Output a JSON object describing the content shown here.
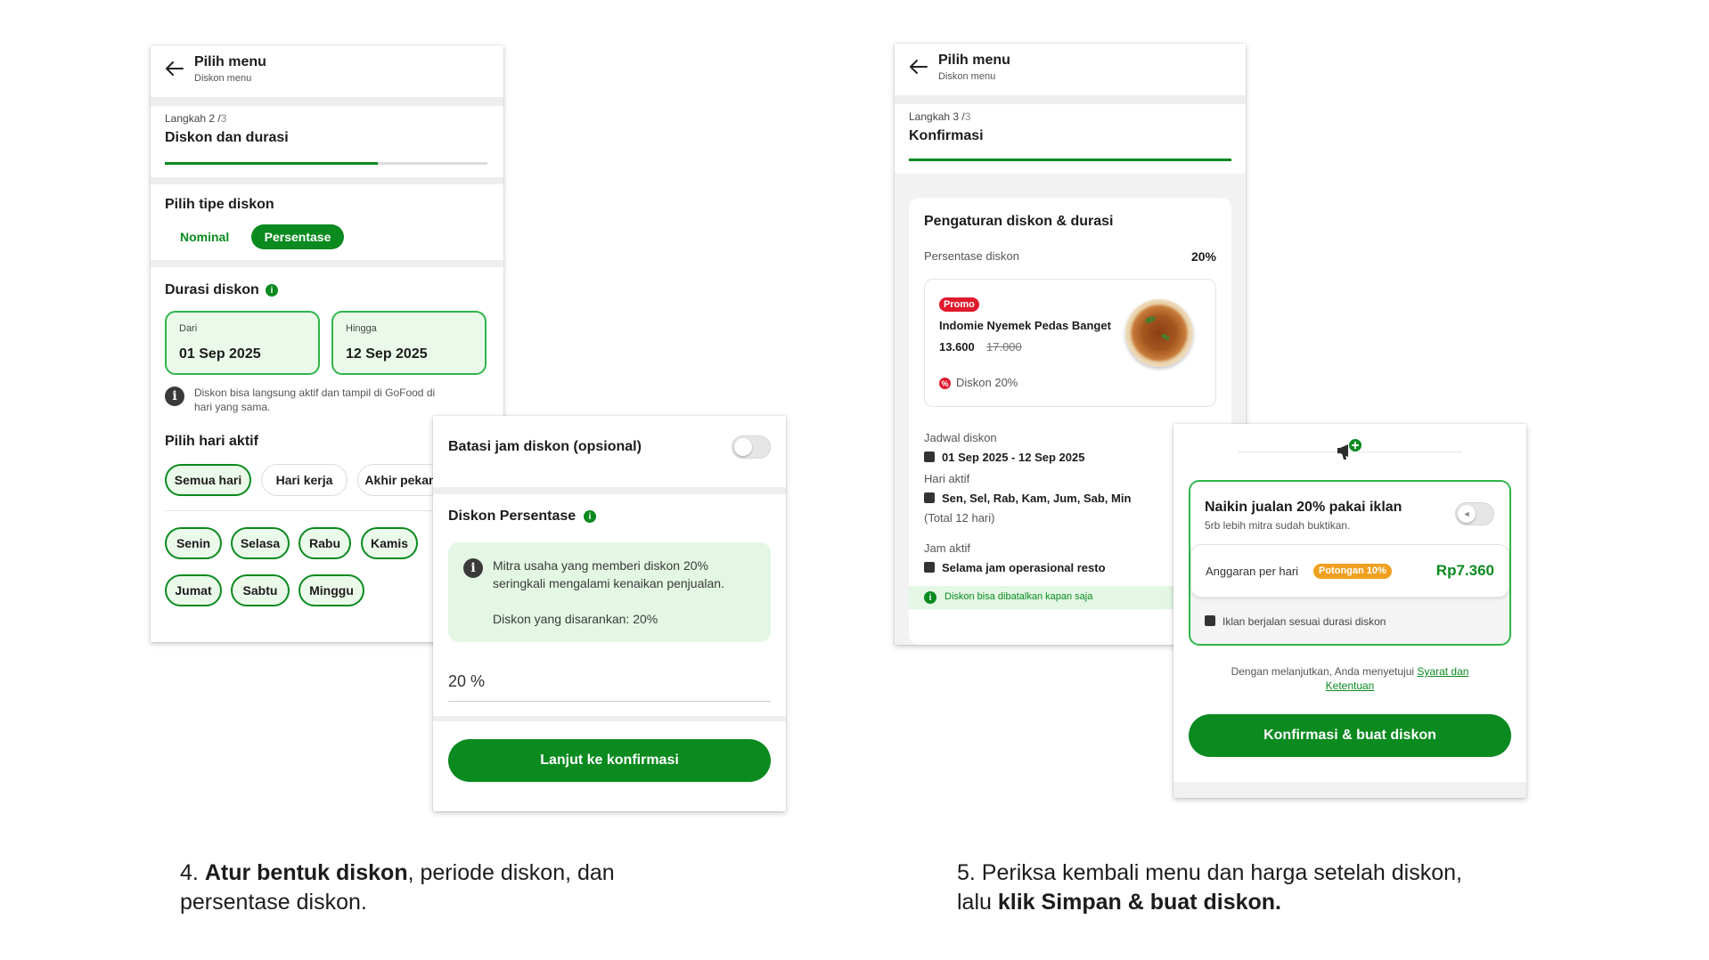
{
  "step4": {
    "header": {
      "title": "Pilih menu",
      "subtitle": "Diskon menu"
    },
    "step": {
      "label": "Langkah 2 /",
      "total": "3",
      "title": "Diskon dan durasi",
      "progress": 0.66
    },
    "type_section": {
      "title": "Pilih tipe diskon",
      "option_nominal": "Nominal",
      "option_percentage": "Persentase"
    },
    "duration": {
      "title": "Durasi diskon",
      "from_label": "Dari",
      "from_value": "01 Sep 2025",
      "to_label": "Hingga",
      "to_value": "12 Sep 2025",
      "note_line1": "Diskon bisa langsung aktif dan tampil di GoFood di",
      "note_line2": "hari yang sama."
    },
    "days": {
      "title": "Pilih hari aktif",
      "presets": [
        "Semua hari",
        "Hari kerja",
        "Akhir pekan"
      ],
      "items": [
        "Senin",
        "Selasa",
        "Rabu",
        "Kamis",
        "Jumat",
        "Sabtu",
        "Minggu"
      ]
    },
    "overlay": {
      "limit_title": "Batasi jam diskon (opsional)",
      "percent_title": "Diskon Persentase",
      "tip_line1": "Mitra usaha yang memberi diskon 20%",
      "tip_line2": "seringkali mengalami kenaikan penjualan.",
      "tip_suggested": "Diskon yang disarankan: 20%",
      "input_value": "20 %",
      "button": "Lanjut ke konfirmasi"
    }
  },
  "step5": {
    "header": {
      "title": "Pilih menu",
      "subtitle": "Diskon menu"
    },
    "step": {
      "label": "Langkah 3 /",
      "total": "3",
      "title": "Konfirmasi",
      "progress": 1.0
    },
    "summary": {
      "title": "Pengaturan diskon & durasi",
      "percent_label": "Persentase diskon",
      "percent_value": "20%",
      "product": {
        "badge": "Promo",
        "name": "Indomie Nyemek Pedas Banget",
        "price": "13.600",
        "old_price": "17.000",
        "discount": "Diskon 20%"
      },
      "schedule_label": "Jadwal diskon",
      "schedule_value": "01 Sep 2025 - 12 Sep 2025",
      "days_label": "Hari aktif",
      "days_value": "Sen, Sel, Rab, Kam, Jum, Sab, Min",
      "days_total": "(Total 12 hari)",
      "hours_label": "Jam aktif",
      "hours_value": "Selama jam operasional resto",
      "cancel_note": "Diskon bisa dibatalkan kapan saja"
    },
    "overlay": {
      "ad_title": "Naikin jualan 20% pakai iklan",
      "ad_sub": "5rb lebih mitra sudah buktikan.",
      "budget_label": "Anggaran per hari",
      "budget_badge": "Potongan 10%",
      "budget_value": "Rp7.360",
      "ad_note": "Iklan berjalan sesuai durasi diskon",
      "terms_prefix": "Dengan melanjutkan, Anda menyetujui",
      "terms_link1": "Syarat dan",
      "terms_link2": "Ketentuan",
      "button": "Konfirmasi & buat diskon"
    }
  },
  "captions": {
    "c4_num": "4.",
    "c4_bold": "Atur bentuk diskon",
    "c4_rest": ", periode diskon, dan",
    "c4_line2": "persentase diskon.",
    "c5_line1": "5. Periksa kembali menu dan harga setelah diskon,",
    "c5_prefix": "lalu",
    "c5_bold": "klik Simpan & buat diskon."
  },
  "colors": {
    "brand_green": "#0a8a1f",
    "light_green": "#eaf9ea",
    "promo_red": "#e0192d",
    "badge_orange": "#f0a020"
  }
}
